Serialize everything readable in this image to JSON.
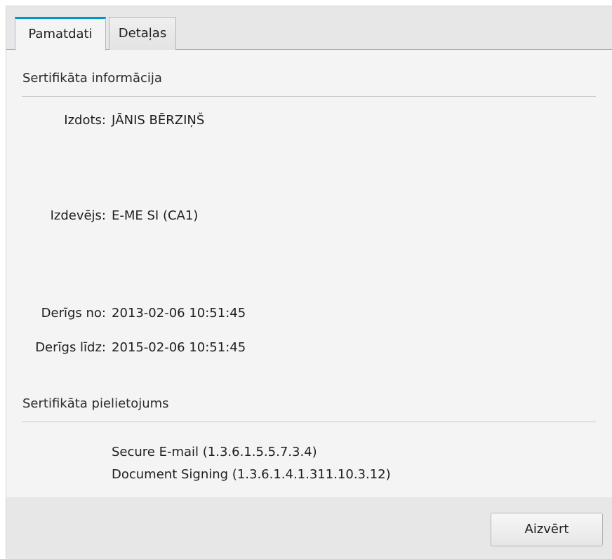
{
  "tabs": [
    {
      "label": "Pamatdati",
      "active": true
    },
    {
      "label": "Detaļas",
      "active": false
    }
  ],
  "info": {
    "section_title": "Sertifikāta informācija",
    "issued_to_label": "Izdots:",
    "issued_to_value": "JĀNIS BĒRZIŅŠ",
    "issuer_label": "Izdevējs:",
    "issuer_value": "E-ME SI (CA1)",
    "valid_from_label": "Derīgs no:",
    "valid_from_value": "2013-02-06 10:51:45",
    "valid_to_label": "Derīgs līdz:",
    "valid_to_value": "2015-02-06 10:51:45"
  },
  "usage": {
    "section_title": "Sertifikāta pielietojums",
    "items": [
      "Secure E-mail (1.3.6.1.5.5.7.3.4)",
      "Document Signing (1.3.6.1.4.1.311.10.3.12)"
    ]
  },
  "footer": {
    "close_label": "Aizvērt"
  },
  "colors": {
    "active_tab_accent": "#0096c9",
    "panel_background": "#f4f4f4",
    "footer_background": "#e7e7e7"
  }
}
